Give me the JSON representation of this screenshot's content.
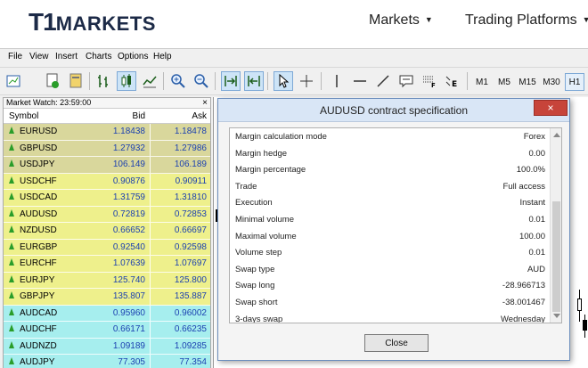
{
  "site": {
    "logo_mark": "T1",
    "logo_text": "MARKETS",
    "nav": [
      {
        "label": "Markets"
      },
      {
        "label": "Trading Platforms"
      }
    ]
  },
  "menu": [
    "File",
    "View",
    "Insert",
    "Charts",
    "Options",
    "Help"
  ],
  "timeframes": [
    {
      "label": "M1",
      "active": false
    },
    {
      "label": "M5",
      "active": false
    },
    {
      "label": "M15",
      "active": false
    },
    {
      "label": "M30",
      "active": false
    },
    {
      "label": "H1",
      "active": true
    }
  ],
  "market_watch": {
    "title": "Market Watch: 23:59:00",
    "close": "×",
    "columns": {
      "symbol": "Symbol",
      "bid": "Bid",
      "ask": "Ask"
    },
    "colors": {
      "olive": "#d9d79c",
      "yellow": "#f1f18a",
      "cyan": "#a6f1ee"
    },
    "rows": [
      {
        "symbol": "EURUSD",
        "bid": "1.18438",
        "ask": "1.18478",
        "color": "#d9d79c"
      },
      {
        "symbol": "GBPUSD",
        "bid": "1.27932",
        "ask": "1.27986",
        "color": "#d9d79c"
      },
      {
        "symbol": "USDJPY",
        "bid": "106.149",
        "ask": "106.189",
        "color": "#d9d79c"
      },
      {
        "symbol": "USDCHF",
        "bid": "0.90876",
        "ask": "0.90911",
        "color": "#eef08c"
      },
      {
        "symbol": "USDCAD",
        "bid": "1.31759",
        "ask": "1.31810",
        "color": "#eef08c"
      },
      {
        "symbol": "AUDUSD",
        "bid": "0.72819",
        "ask": "0.72853",
        "color": "#eef08c"
      },
      {
        "symbol": "NZDUSD",
        "bid": "0.66652",
        "ask": "0.66697",
        "color": "#eef08c"
      },
      {
        "symbol": "EURGBP",
        "bid": "0.92540",
        "ask": "0.92598",
        "color": "#eef08c"
      },
      {
        "symbol": "EURCHF",
        "bid": "1.07639",
        "ask": "1.07697",
        "color": "#eef08c"
      },
      {
        "symbol": "EURJPY",
        "bid": "125.740",
        "ask": "125.800",
        "color": "#eef08c"
      },
      {
        "symbol": "GBPJPY",
        "bid": "135.807",
        "ask": "135.887",
        "color": "#eef08c"
      },
      {
        "symbol": "AUDCAD",
        "bid": "0.95960",
        "ask": "0.96002",
        "color": "#a6eeee"
      },
      {
        "symbol": "AUDCHF",
        "bid": "0.66171",
        "ask": "0.66235",
        "color": "#a6eeee"
      },
      {
        "symbol": "AUDNZD",
        "bid": "1.09189",
        "ask": "1.09285",
        "color": "#a6eeee"
      },
      {
        "symbol": "AUDJPY",
        "bid": "77.305",
        "ask": "77.354",
        "color": "#a6eeee"
      }
    ]
  },
  "dialog": {
    "title": "AUDUSD contract specification",
    "close_icon": "×",
    "rows": [
      {
        "key": "Margin calculation mode",
        "value": "Forex"
      },
      {
        "key": "Margin hedge",
        "value": "0.00"
      },
      {
        "key": "Margin percentage",
        "value": "100.0%"
      },
      {
        "key": "Trade",
        "value": "Full access"
      },
      {
        "key": "Execution",
        "value": "Instant"
      },
      {
        "key": "Minimal volume",
        "value": "0.01"
      },
      {
        "key": "Maximal volume",
        "value": "100.00"
      },
      {
        "key": "Volume step",
        "value": "0.01"
      },
      {
        "key": "Swap type",
        "value": "AUD"
      },
      {
        "key": "Swap long",
        "value": "-28.966713"
      },
      {
        "key": "Swap short",
        "value": "-38.001467"
      },
      {
        "key": "3-days swap",
        "value": "Wednesday"
      }
    ],
    "close_button": "Close"
  }
}
